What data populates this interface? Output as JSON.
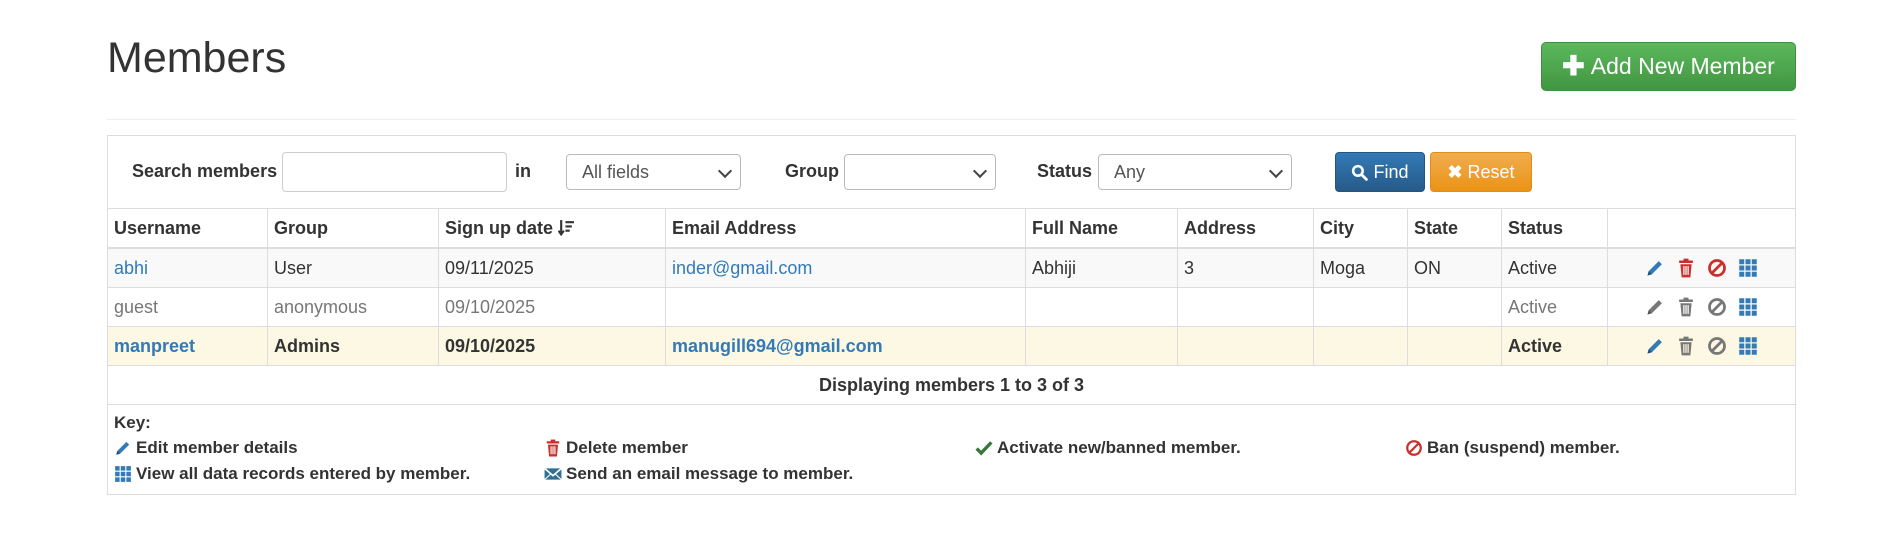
{
  "page": {
    "title": "Members"
  },
  "add_button": {
    "label": "Add New Member"
  },
  "search": {
    "search_label": "Search members",
    "in_label": "in",
    "field_select": "All fields",
    "group_label": "Group",
    "group_select": "",
    "status_label": "Status",
    "status_select": "Any",
    "find_label": "Find",
    "reset_label": "Reset"
  },
  "table": {
    "headers": [
      "Username",
      "Group",
      "Sign up date",
      "Email Address",
      "Full Name",
      "Address",
      "City",
      "State",
      "Status",
      ""
    ],
    "rows": [
      {
        "username": "abhi",
        "group": "User",
        "signup": "09/11/2025",
        "email": "inder@gmail.com",
        "fullname": "Abhiji",
        "address": "3",
        "city": "Moga",
        "state": "ON",
        "status": "Active"
      },
      {
        "username": "guest",
        "group": "anonymous",
        "signup": "09/10/2025",
        "email": "",
        "fullname": "",
        "address": "",
        "city": "",
        "state": "",
        "status": "Active"
      },
      {
        "username": "manpreet",
        "group": "Admins",
        "signup": "09/10/2025",
        "email": "manugill694@gmail.com",
        "fullname": "",
        "address": "",
        "city": "",
        "state": "",
        "status": "Active"
      }
    ],
    "displaying": "Displaying members 1 to 3 of 3"
  },
  "key": {
    "title": "Key:",
    "edit": "Edit member details",
    "delete": "Delete member",
    "activate": "Activate new/banned member.",
    "ban": "Ban (suspend) member.",
    "view": "View all data records entered by member.",
    "email": "Send an email message to member."
  },
  "colors": {
    "link": "#337ab7",
    "success": "#5cb85c",
    "primary": "#337ab7",
    "warning": "#f0ad4e",
    "danger": "#c9302c",
    "highlight": "#fcf8e3"
  },
  "icons": [
    "plus-icon",
    "search-icon",
    "close-icon",
    "sort-desc-icon",
    "pencil-icon",
    "trash-icon",
    "ban-icon",
    "grid-icon",
    "check-icon",
    "envelope-icon"
  ]
}
